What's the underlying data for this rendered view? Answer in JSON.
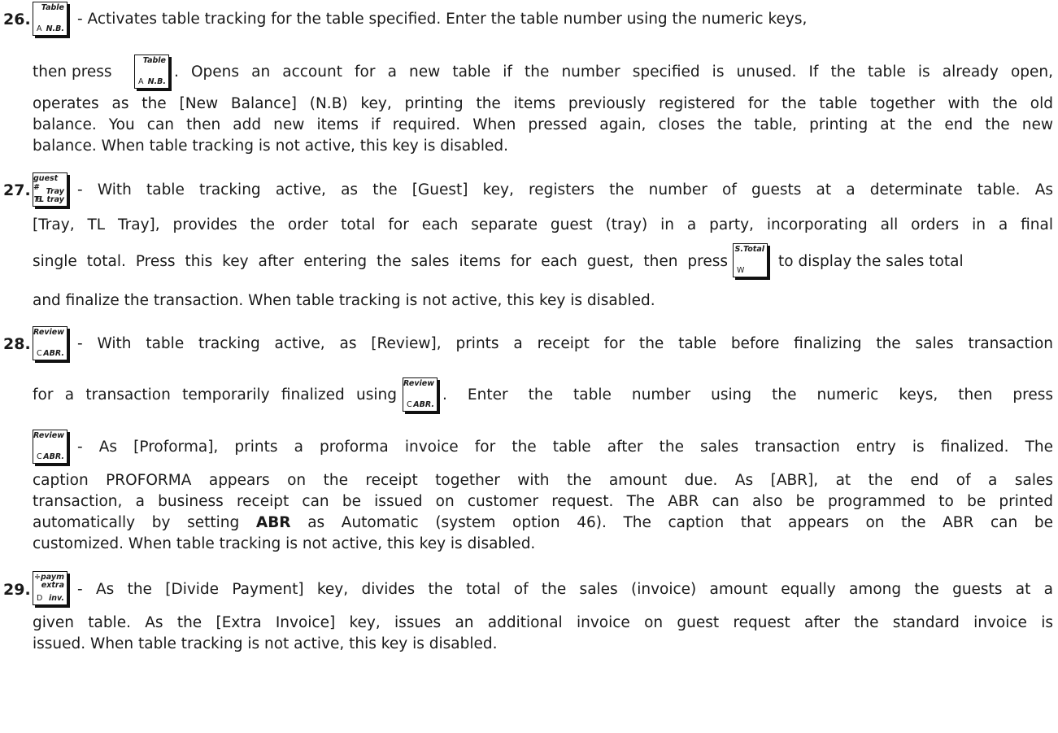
{
  "items": {
    "i26": {
      "number": "26.",
      "key": {
        "top": "Table",
        "letter": "A",
        "bottom": "N.B."
      },
      "line1": "- Activates table tracking for the table specified. Enter the table number using the numeric keys,",
      "line2_pre": "then press",
      "line2_post": ". Opens an account for a new table if the number specified is unused. If the table is already open,",
      "line3": "operates as the [New Balance] (N.B) key, printing the items previously registered for the table together with the old",
      "line4": "balance. You can then add new items if required. When pressed again, closes the table, printing at the end the new",
      "line5": "balance. When table tracking is not active, this key is disabled."
    },
    "i27": {
      "number": "27.",
      "key": {
        "top": "guest #",
        "mid": "Tray",
        "letter": "B",
        "bottom": "TL tray"
      },
      "line1": "- With table tracking active, as the [Guest] key, registers the number of guests at a determinate table. As",
      "line2": "[Tray, TL Tray], provides the order total for each separate guest (tray) in a party, incorporating all orders in a final",
      "line3_pre": "single total. Press this key after entering the sales items for each guest, then press",
      "line3_post": "to display the sales total",
      "subtotal_key": {
        "top": "S.Total",
        "letter": "W"
      },
      "line4": "and finalize the transaction. When table tracking is not active, this key is disabled."
    },
    "i28": {
      "number": "28.",
      "key": {
        "top": "Review",
        "letter": "C",
        "bottom": "ABR."
      },
      "line1": "- With table tracking active, as [Review], prints a receipt for the table before finalizing the sales transaction",
      "line2_pre": "for a transaction temporarily finalized using",
      "line2_post": ". Enter the table number using the numeric keys, then press",
      "line3": "- As [Proforma], prints a proforma invoice for the table after the sales transaction entry is finalized. The",
      "line4": "caption PROFORMA appears on the receipt together with the amount due. As [ABR], at the end of a sales",
      "line5": "transaction, a business receipt can be issued on customer request. The ABR can also be programmed to be printed",
      "line6_pre": "automatically by setting",
      "line6_bold": "ABR",
      "line6_post": "as Automatic (system option 46). The caption that appears on the ABR can be",
      "line7": "customized. When table tracking is not active, this key is disabled."
    },
    "i29": {
      "number": "29.",
      "key": {
        "top": "÷paym",
        "mid": "extra",
        "letter": "D",
        "bottom": "inv."
      },
      "line1": "- As the [Divide Payment] key, divides the total of the sales (invoice) amount equally among the guests at a",
      "line2": "given table. As the [Extra Invoice] key, issues an additional invoice on guest request after the standard invoice is",
      "line3": "issued. When table tracking is not active, this key is disabled."
    }
  }
}
